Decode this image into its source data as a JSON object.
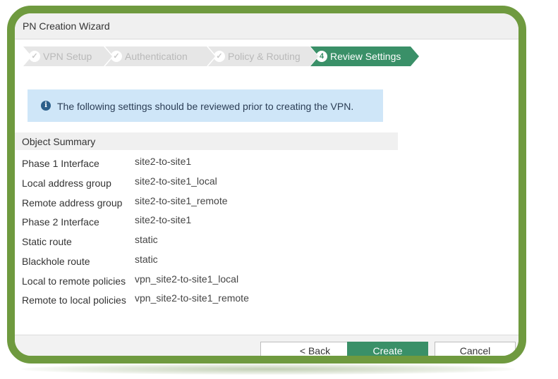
{
  "window": {
    "title": "PN Creation Wizard"
  },
  "steps": [
    {
      "label": "VPN Setup",
      "icon": "✓",
      "state": "done"
    },
    {
      "label": "Authentication",
      "icon": "✓",
      "state": "done"
    },
    {
      "label": "Policy & Routing",
      "icon": "✓",
      "state": "done"
    },
    {
      "label": "Review Settings",
      "icon": "4",
      "state": "active"
    }
  ],
  "info": {
    "icon": "info-icon",
    "message": "The following settings should be reviewed prior to creating the VPN."
  },
  "summary": {
    "title": "Object Summary",
    "rows": [
      {
        "key": "Phase 1 Interface",
        "value": "site2-to-site1"
      },
      {
        "key": "Local address group",
        "value": "site2-to-site1_local"
      },
      {
        "key": "Remote address group",
        "value": "site2-to-site1_remote"
      },
      {
        "key": "Phase 2 Interface",
        "value": "site2-to-site1"
      },
      {
        "key": "Static route",
        "value": "static"
      },
      {
        "key": "Blackhole route",
        "value": "static"
      },
      {
        "key": "Local to remote policies",
        "value": "vpn_site2-to-site1_local"
      },
      {
        "key": "Remote to local policies",
        "value": "vpn_site2-to-site1_remote"
      }
    ]
  },
  "buttons": {
    "back": "< Back",
    "create": "Create",
    "cancel": "Cancel"
  },
  "colors": {
    "frame": "#6f9a3f",
    "accent": "#3a9068",
    "info_bg": "#cfe6f8"
  }
}
